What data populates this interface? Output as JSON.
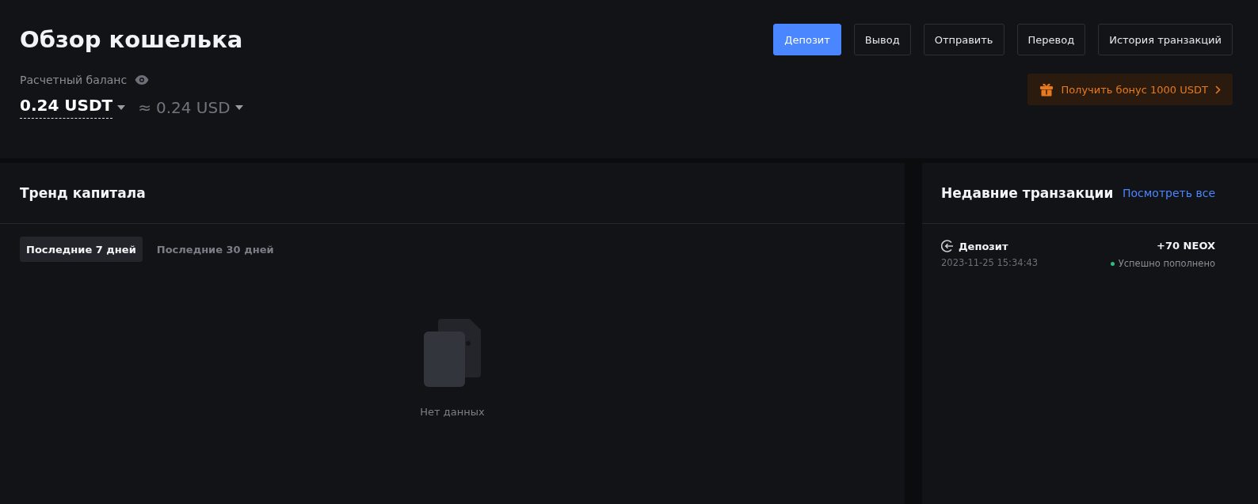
{
  "header": {
    "title": "Обзор кошелька",
    "balance_label": "Расчетный баланс",
    "balance": "0.24 USDT",
    "approx_sign": "≈",
    "balance_usd": "0.24 USD"
  },
  "actions": [
    {
      "label": "Депозит",
      "kind": "primary"
    },
    {
      "label": "Вывод",
      "kind": "outline"
    },
    {
      "label": "Отправить",
      "kind": "outline"
    },
    {
      "label": "Перевод",
      "kind": "outline"
    },
    {
      "label": "История транзакций",
      "kind": "outline"
    }
  ],
  "bonus": {
    "label": "Получить бонус 1000 USDT"
  },
  "trend": {
    "title": "Тренд капитала",
    "tabs": [
      {
        "label": "Последние 7 дней",
        "selected": true
      },
      {
        "label": "Последние 30 дней",
        "selected": false
      }
    ],
    "empty": "Нет данных"
  },
  "recent": {
    "title": "Недавние транзакции",
    "view_all": "Посмотреть все",
    "items": [
      {
        "type": "Депозит",
        "date": "2023-11-25 15:34:43",
        "amount": "+70 NEOX",
        "status": "Успешно пополнено",
        "color": "#2ebd85"
      }
    ]
  }
}
